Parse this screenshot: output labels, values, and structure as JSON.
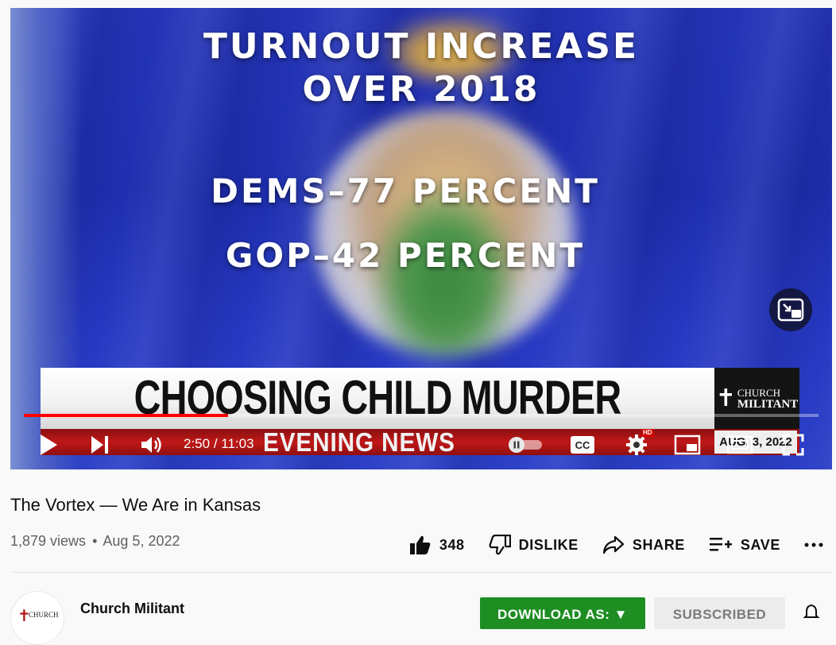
{
  "video": {
    "overlay": {
      "line1": "TURNOUT INCREASE",
      "line2": "OVER 2018",
      "line3": "DEMS–77 PERCENT",
      "line4": "GOP–42 PERCENT"
    },
    "banner": {
      "headline": "CHOOSING CHILD MURDER",
      "subhead": "EVENING NEWS",
      "logo_line1": "CHURCH",
      "logo_line2": "MILITANT",
      "date": "AUG. 3, 2022"
    },
    "progress_fraction": 0.257,
    "time_current": "2:50",
    "time_separator": " / ",
    "time_total": "11:03",
    "hd_badge": "HD",
    "cc_label": "CC"
  },
  "info": {
    "title": "The Vortex — We Are in Kansas",
    "views": "1,879 views",
    "separator": "•",
    "date": "Aug 5, 2022"
  },
  "actions": {
    "like_count": "348",
    "dislike_label": "DISLIKE",
    "share_label": "SHARE",
    "save_label": "SAVE"
  },
  "channel": {
    "name": "Church Militant",
    "avatar_text": "CHURCH"
  },
  "buttons": {
    "download_label": "DOWNLOAD AS: ▼",
    "subscribe_label": "SUBSCRIBED"
  },
  "colors": {
    "progress": "#ff0000",
    "download": "#1e8e23",
    "banner_red": "#c01818"
  }
}
